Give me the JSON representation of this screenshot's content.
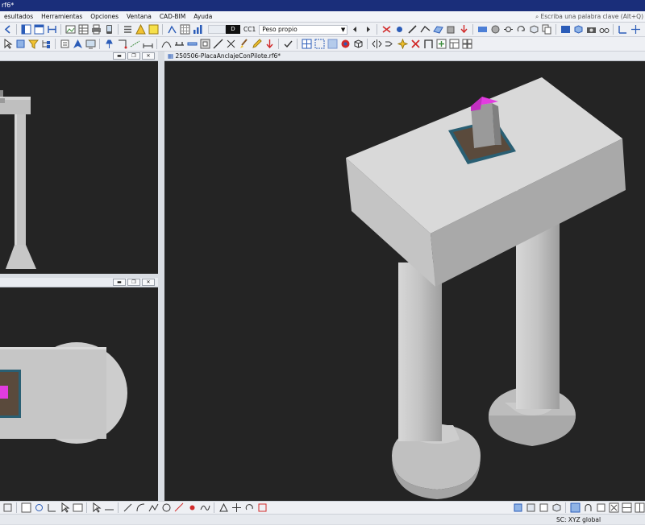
{
  "titlebar": {
    "title": "rf6*"
  },
  "menu": {
    "items": [
      "esultados",
      "Herramientas",
      "Opciones",
      "Ventana",
      "CAD-BIM",
      "Ayuda"
    ],
    "search_placeholder": "Escriba una palabra clave (Alt+Q)"
  },
  "loadcase": {
    "type": "D",
    "code": "CC1",
    "name": "Peso propio"
  },
  "views": {
    "main_title": "250506-PlacaAnclajeConPilote.rf6*"
  },
  "status": {
    "coord_system": "SC: XYZ global"
  },
  "colors": {
    "accent": "#1a2e7a",
    "viewport": "#242424",
    "concrete": "#c9c9c9",
    "column_top": "#e23ce0"
  }
}
